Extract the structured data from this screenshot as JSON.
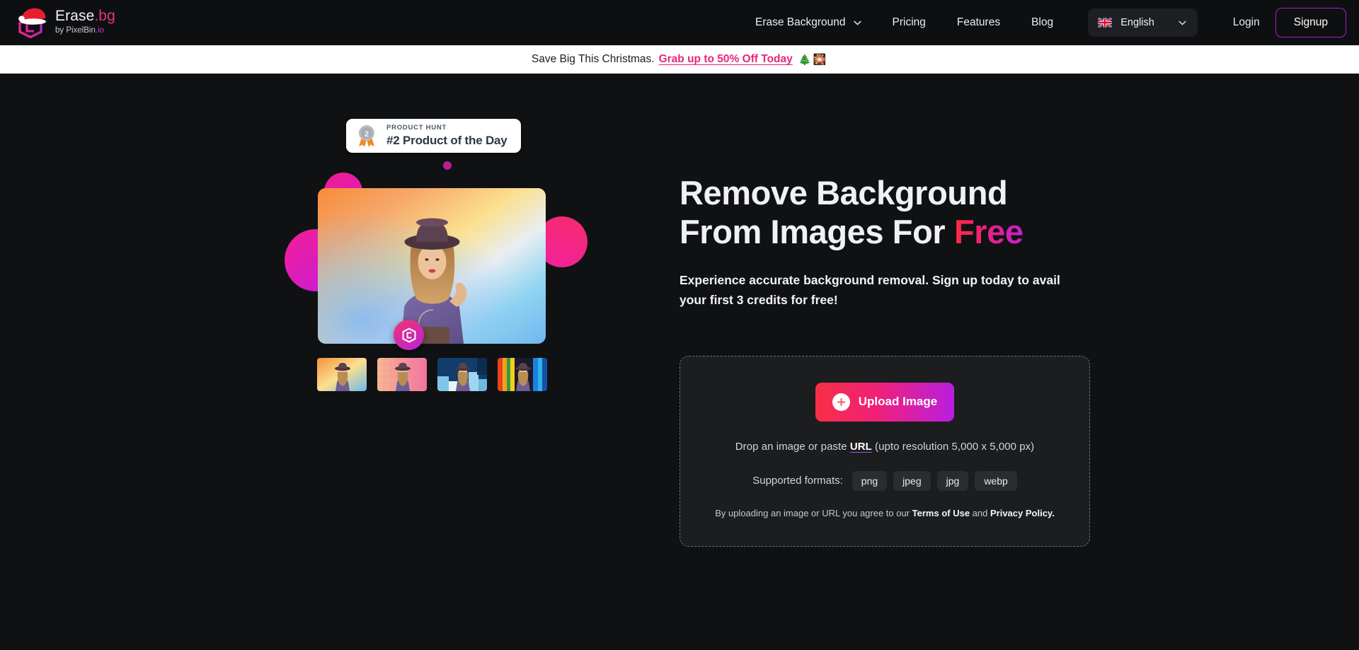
{
  "header": {
    "logo": {
      "title": "Erase",
      "title_dot": ".bg",
      "subtitle_prefix": "by PixelBin",
      "subtitle_suffix": ".io",
      "icon": "pixelbin-cube-logo-with-santa-hat"
    },
    "nav": [
      {
        "label": "Erase Background",
        "has_dropdown": true
      },
      {
        "label": "Pricing",
        "has_dropdown": false
      },
      {
        "label": "Features",
        "has_dropdown": false
      },
      {
        "label": "Blog",
        "has_dropdown": false
      }
    ],
    "language": {
      "label": "English",
      "flag": "uk-flag-icon"
    },
    "login_label": "Login",
    "signup_label": "Signup"
  },
  "promo_banner": {
    "text": "Save Big This Christmas.",
    "cta": "Grab up to 50% Off Today",
    "emojis": "🎄🎇"
  },
  "hero": {
    "product_hunt": {
      "kicker": "PRODUCT HUNT",
      "title": "#2 Product of the Day",
      "medal_icon": "silver-medal-2-icon"
    },
    "headline_line1": "Remove Background",
    "headline_line2_plain": "From Images For ",
    "headline_line2_accent": "Free",
    "subheadline": "Experience accurate background removal. Sign up today to avail your first 3 credits for free!",
    "thumbnails": [
      {
        "name": "thumbnail-gradient-sunset",
        "selected": false
      },
      {
        "name": "thumbnail-pink-tiles",
        "selected": true
      },
      {
        "name": "thumbnail-blue-blocks",
        "selected": false
      },
      {
        "name": "thumbnail-rainbow-stripes",
        "selected": false
      }
    ]
  },
  "upload": {
    "button_label": "Upload Image",
    "plus_icon": "plus-icon",
    "drop_prefix": "Drop an image or paste ",
    "drop_url": "URL",
    "drop_suffix": " (upto resolution 5,000 x 5,000 px)",
    "formats_label": "Supported formats:",
    "formats": [
      "png",
      "jpeg",
      "jpg",
      "webp"
    ],
    "legal_prefix": "By uploading an image or URL you agree to our ",
    "legal_terms": "Terms of Use",
    "legal_mid": " and ",
    "legal_privacy": "Privacy Policy."
  },
  "colors": {
    "page_bg": "#101113",
    "header_bg": "#0e0f11",
    "accent_pink": "#e8257f",
    "accent_purple": "#a71ed2",
    "gradient_start": "#f82f46",
    "gradient_end": "#b91fdf",
    "banner_bg": "#ffffff",
    "card_bg": "#1b1d1e",
    "card_border": "#6c6e72"
  }
}
